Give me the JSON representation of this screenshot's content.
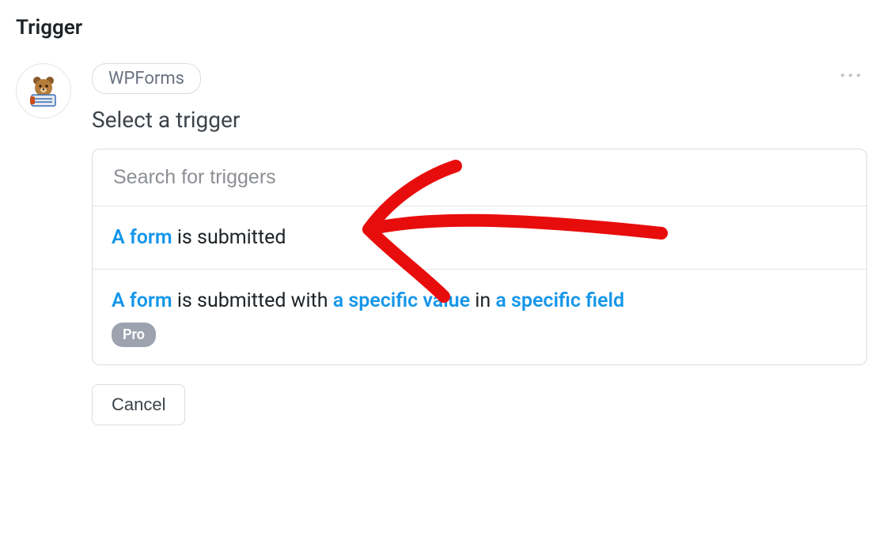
{
  "page_title": "Trigger",
  "integration_name": "WPForms",
  "subtitle": "Select a trigger",
  "search_placeholder": "Search for triggers",
  "options": [
    {
      "var1": "A form",
      "plain1": " is submitted"
    },
    {
      "var1": "A form",
      "plain1": " is submitted with ",
      "var2": "a specific value",
      "plain2": " in ",
      "var3": "a specific field",
      "pro": true
    }
  ],
  "pro_label": "Pro",
  "cancel_label": "Cancel",
  "annotation": {
    "color": "#e80d0d"
  }
}
